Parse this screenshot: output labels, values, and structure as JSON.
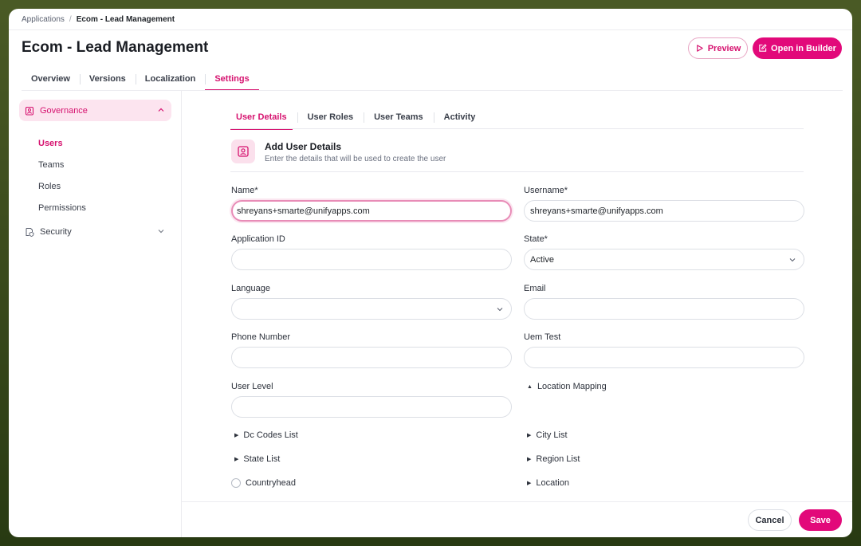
{
  "breadcrumb": {
    "root": "Applications",
    "separator": "/",
    "current": "Ecom - Lead Management"
  },
  "header": {
    "title": "Ecom - Lead Management",
    "preview_label": "Preview",
    "builder_label": "Open in Builder"
  },
  "main_tabs": [
    {
      "label": "Overview"
    },
    {
      "label": "Versions"
    },
    {
      "label": "Localization"
    },
    {
      "label": "Settings",
      "active": true
    }
  ],
  "sidebar": {
    "governance": {
      "label": "Governance",
      "expanded": true
    },
    "items": [
      {
        "label": "Users",
        "active": true
      },
      {
        "label": "Teams"
      },
      {
        "label": "Roles"
      },
      {
        "label": "Permissions"
      }
    ],
    "security": {
      "label": "Security",
      "expanded": false
    }
  },
  "sub_tabs": [
    {
      "label": "User Details",
      "active": true
    },
    {
      "label": "User Roles"
    },
    {
      "label": "User Teams"
    },
    {
      "label": "Activity"
    }
  ],
  "section": {
    "title": "Add User Details",
    "subtitle": "Enter the details that will be used to create the user"
  },
  "form": {
    "name": {
      "label": "Name*",
      "value": "shreyans+smarte@unifyapps.com"
    },
    "username": {
      "label": "Username*",
      "value": "shreyans+smarte@unifyapps.com"
    },
    "application_id": {
      "label": "Application ID",
      "value": ""
    },
    "state": {
      "label": "State*",
      "value": "Active"
    },
    "language": {
      "label": "Language",
      "value": ""
    },
    "email": {
      "label": "Email",
      "value": ""
    },
    "phone": {
      "label": "Phone Number",
      "value": ""
    },
    "uem_test": {
      "label": "Uem Test",
      "value": ""
    },
    "user_level": {
      "label": "User Level",
      "value": ""
    },
    "location_mapping": {
      "label": "Location Mapping",
      "expanded": true
    },
    "dc_codes": {
      "label": "Dc Codes List"
    },
    "city_list": {
      "label": "City List"
    },
    "state_list": {
      "label": "State List"
    },
    "region_list": {
      "label": "Region List"
    },
    "countryhead": {
      "label": "Countryhead",
      "checked": false
    },
    "location": {
      "label": "Location"
    }
  },
  "footer": {
    "cancel_label": "Cancel",
    "save_label": "Save"
  },
  "colors": {
    "accent": "#e2097a",
    "accent_text": "#d6126f",
    "accent_soft": "#fce4ef"
  }
}
